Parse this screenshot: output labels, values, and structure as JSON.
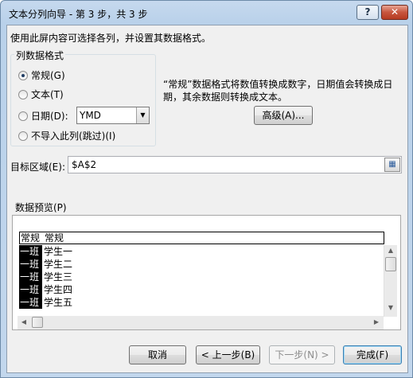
{
  "window": {
    "title": "文本分列向导 - 第 3 步，共 3 步",
    "help_label": "?",
    "close_label": "✕"
  },
  "instruction": "使用此屏内容可选择各列，并设置其数据格式。",
  "column_format": {
    "legend": "列数据格式",
    "options": [
      {
        "label": "常规(G)",
        "checked": true
      },
      {
        "label": "文本(T)",
        "checked": false
      },
      {
        "label": "日期(D):",
        "checked": false
      },
      {
        "label": "不导入此列(跳过)(I)",
        "checked": false
      }
    ],
    "date_select_value": "YMD"
  },
  "description": "“常规”数据格式将数值转换成数字，日期值会转换成日期，其余数据则转换成文本。",
  "advanced_button": "高级(A)...",
  "target": {
    "label": "目标区域(E):",
    "value": "$A$2",
    "collapse_icon": "range-select-icon"
  },
  "preview": {
    "label": "数据预览(P)",
    "headers": [
      "常规",
      "常规"
    ],
    "rows": [
      [
        "一班",
        "学生一"
      ],
      [
        "一班",
        "学生二"
      ],
      [
        "一班",
        "学生三"
      ],
      [
        "一班",
        "学生四"
      ],
      [
        "一班",
        "学生五"
      ]
    ]
  },
  "buttons": {
    "cancel": "取消",
    "back": "< 上一步(B)",
    "next": "下一步(N) >",
    "finish": "完成(F)"
  }
}
